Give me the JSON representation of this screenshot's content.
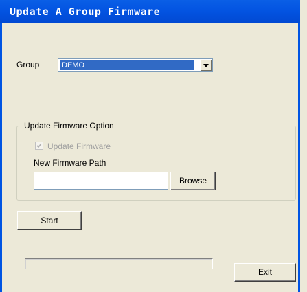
{
  "window": {
    "title": "Update A Group Firmware"
  },
  "group": {
    "label": "Group",
    "selected": "DEMO"
  },
  "firmware_option": {
    "legend": "Update Firmware Option",
    "update_checkbox_label": "Update Firmware",
    "update_checked": true,
    "update_enabled": false,
    "path_label": "New Firmware Path",
    "path_value": "",
    "browse_label": "Browse"
  },
  "start_label": "Start",
  "exit_label": "Exit",
  "progress": {
    "value": 0
  },
  "icons": {
    "dropdown": "chevron-down-icon",
    "check": "checkmark-icon"
  },
  "colors": {
    "titlebar": "#0054e3",
    "selection": "#316ac5",
    "window_bg": "#ece9d8"
  }
}
